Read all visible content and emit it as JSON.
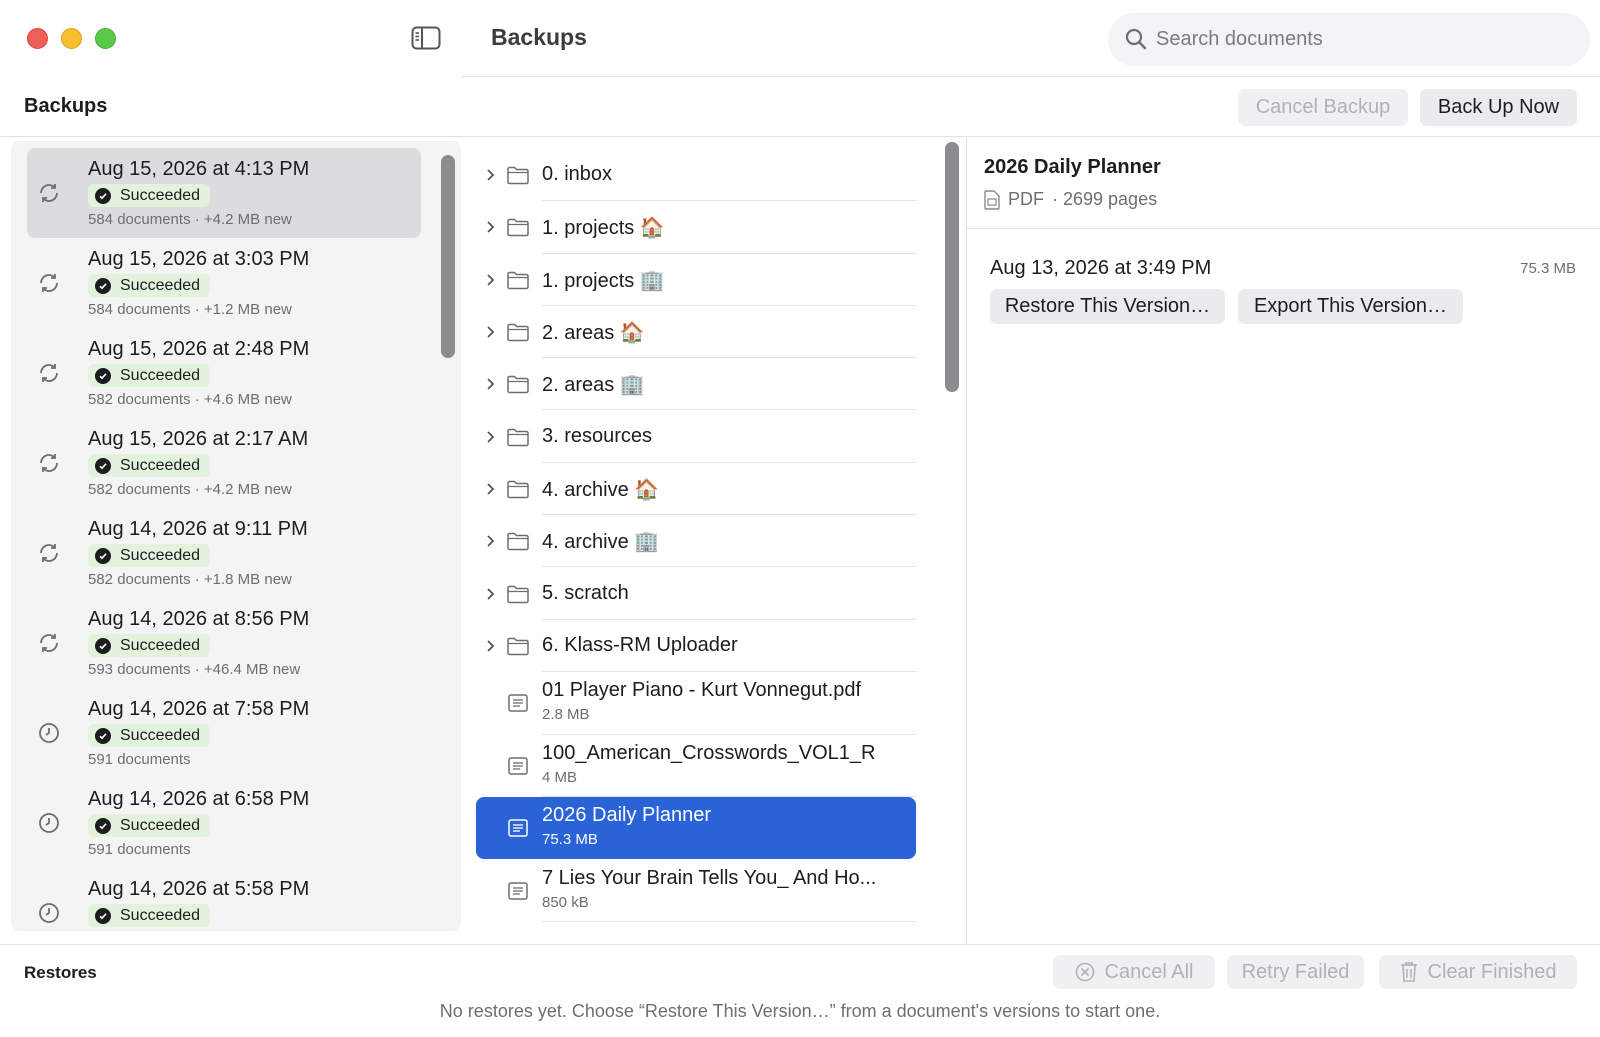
{
  "window": {
    "title": "Backups",
    "search_placeholder": "Search documents"
  },
  "toolbar": {
    "section_label": "Backups",
    "cancel_backup_label": "Cancel Backup",
    "back_up_now_label": "Back Up Now"
  },
  "backups": [
    {
      "date": "Aug 15, 2026 at 4:13 PM",
      "status": "Succeeded",
      "meta": "584 documents · +4.2 MB new",
      "icon": "sync-icon",
      "selected": true
    },
    {
      "date": "Aug 15, 2026 at 3:03 PM",
      "status": "Succeeded",
      "meta": "584 documents · +1.2 MB new",
      "icon": "sync-icon"
    },
    {
      "date": "Aug 15, 2026 at 2:48 PM",
      "status": "Succeeded",
      "meta": "582 documents · +4.6 MB new",
      "icon": "sync-icon"
    },
    {
      "date": "Aug 15, 2026 at 2:17 AM",
      "status": "Succeeded",
      "meta": "582 documents · +4.2 MB new",
      "icon": "sync-icon"
    },
    {
      "date": "Aug 14, 2026 at 9:11 PM",
      "status": "Succeeded",
      "meta": "582 documents · +1.8 MB new",
      "icon": "sync-icon"
    },
    {
      "date": "Aug 14, 2026 at 8:56 PM",
      "status": "Succeeded",
      "meta": "593 documents · +46.4 MB new",
      "icon": "sync-icon"
    },
    {
      "date": "Aug 14, 2026 at 7:58 PM",
      "status": "Succeeded",
      "meta": "591 documents",
      "icon": "clock-icon"
    },
    {
      "date": "Aug 14, 2026 at 6:58 PM",
      "status": "Succeeded",
      "meta": "591 documents",
      "icon": "clock-icon"
    },
    {
      "date": "Aug 14, 2026 at 5:58 PM",
      "status": "Succeeded",
      "meta": "",
      "icon": "clock-icon"
    }
  ],
  "files": [
    {
      "name": "0. inbox",
      "type": "folder"
    },
    {
      "name": "1. projects 🏠",
      "type": "folder"
    },
    {
      "name": "1. projects 🏢",
      "type": "folder"
    },
    {
      "name": "2. areas 🏠",
      "type": "folder"
    },
    {
      "name": "2. areas 🏢",
      "type": "folder"
    },
    {
      "name": "3. resources",
      "type": "folder"
    },
    {
      "name": "4. archive 🏠",
      "type": "folder"
    },
    {
      "name": "4. archive 🏢",
      "type": "folder"
    },
    {
      "name": "5. scratch",
      "type": "folder"
    },
    {
      "name": "6. Klass-RM Uploader",
      "type": "folder"
    },
    {
      "name": "01 Player Piano - Kurt Vonnegut.pdf",
      "size": "2.8 MB",
      "type": "document"
    },
    {
      "name": "100_American_Crosswords_VOL1_R",
      "size": "4 MB",
      "type": "document"
    },
    {
      "name": "2026 Daily Planner",
      "size": "75.3 MB",
      "type": "document",
      "selected": true
    },
    {
      "name": "7 Lies Your Brain Tells You_ And Ho...",
      "size": "850 kB",
      "type": "document"
    }
  ],
  "detail": {
    "title": "2026 Daily Planner",
    "kind": "PDF",
    "pages": "· 2699 pages",
    "version_date": "Aug 13, 2026 at 3:49 PM",
    "version_size": "75.3 MB",
    "restore_label": "Restore This Version…",
    "export_label": "Export This Version…"
  },
  "restores": {
    "label": "Restores",
    "cancel_all_label": "Cancel All",
    "retry_failed_label": "Retry Failed",
    "clear_finished_label": "Clear Finished",
    "empty_hint": "No restores yet. Choose “Restore This Version…” from a document's versions to start one."
  },
  "colors": {
    "accent": "#2a63d8",
    "success_badge": "#e2f2dd"
  }
}
